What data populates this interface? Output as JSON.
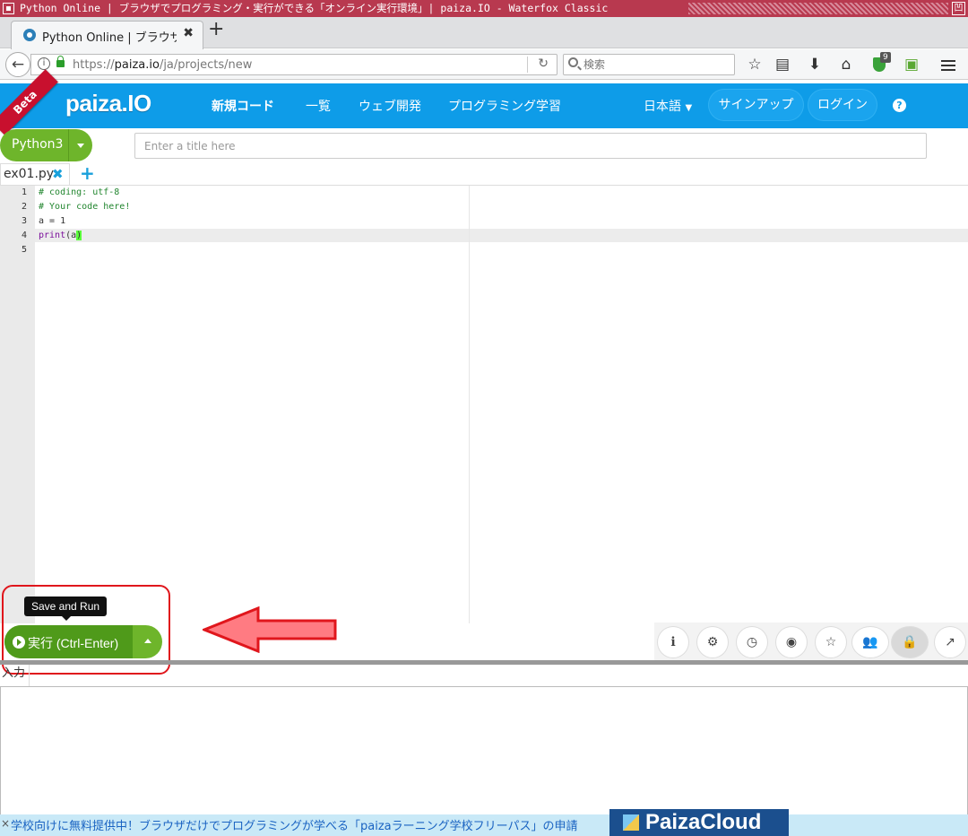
{
  "window": {
    "title": "Python Online | ブラウザでプログラミング・実行ができる「オンライン実行環境」| paiza.IO - Waterfox Classic"
  },
  "browser": {
    "tab_title": "Python Online | ブラウザ",
    "url_prefix": "https://",
    "url_host": "paiza.io",
    "url_path": "/ja/projects/new",
    "search_placeholder": "検索",
    "ublock_count": "9"
  },
  "paiza_header": {
    "beta_label": "Beta",
    "logo_text": "paiza.IO",
    "nav": [
      "新規コード",
      "一覧",
      "ウェブ開発",
      "プログラミング学習"
    ],
    "language": "日本語",
    "signup": "サインアップ",
    "login": "ログイン",
    "help": "?"
  },
  "editor": {
    "language": "Python3",
    "title_placeholder": "Enter a title here",
    "file_tab": "ex01.py",
    "line_numbers": [
      "1",
      "2",
      "3",
      "4",
      "5"
    ],
    "lines": {
      "l1": "# coding: utf-8",
      "l2": "# Your code here!",
      "l3": "a = 1",
      "l4_kw": "print",
      "l4_open": "(",
      "l4_arg": "a",
      "l4_close": ")"
    }
  },
  "run": {
    "tooltip": "Save and Run",
    "label": "実行 (Ctrl-Enter)"
  },
  "input_panel": {
    "tab": "入力"
  },
  "footer": {
    "close": "×",
    "message": "学校向けに無料提供中！ブラウザだけでプログラミングが学べる「paizaラーニング学校フリーパス」の申請",
    "banner": "PaizaCloud"
  }
}
